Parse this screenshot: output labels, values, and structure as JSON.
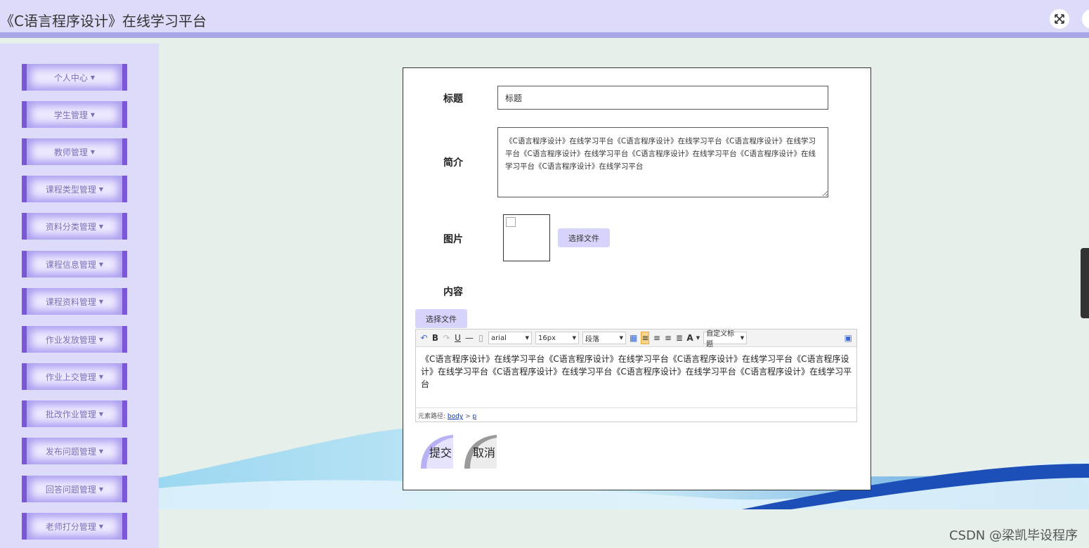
{
  "header": {
    "title": "《C语言程序设计》在线学习平台",
    "fullscreen_icon": "expand-icon",
    "user_icon": "user-icon"
  },
  "sidebar": {
    "items": [
      {
        "label": "个人中心"
      },
      {
        "label": "学生管理"
      },
      {
        "label": "教师管理"
      },
      {
        "label": "课程类型管理"
      },
      {
        "label": "资料分类管理"
      },
      {
        "label": "课程信息管理"
      },
      {
        "label": "课程资料管理"
      },
      {
        "label": "作业发放管理"
      },
      {
        "label": "作业上交管理"
      },
      {
        "label": "批改作业管理"
      },
      {
        "label": "发布问题管理"
      },
      {
        "label": "回答问题管理"
      },
      {
        "label": "老师打分管理"
      }
    ]
  },
  "form": {
    "title_label": "标题",
    "title_value": "标题",
    "intro_label": "简介",
    "intro_value": "《C语言程序设计》在线学习平台《C语言程序设计》在线学习平台《C语言程序设计》在线学习平台《C语言程序设计》在线学习平台《C语言程序设计》在线学习平台《C语言程序设计》在线学习平台《C语言程序设计》在线学习平台",
    "image_label": "图片",
    "file_button": "选择文件",
    "content_label": "内容",
    "editor_file_button": "选择文件",
    "submit": "提交",
    "cancel": "取消"
  },
  "editor": {
    "font_family": "arial",
    "font_size": "16px",
    "paragraph": "段落",
    "custom_title": "自定义标题",
    "bold": "B",
    "underline": "U",
    "font_color": "A",
    "content": "《C语言程序设计》在线学习平台《C语言程序设计》在线学习平台《C语言程序设计》在线学习平台《C语言程序设计》在线学习平台《C语言程序设计》在线学习平台《C语言程序设计》在线学习平台《C语言程序设计》在线学习平台",
    "path_label": "元素路径:",
    "path_body": "body",
    "path_sep": ">",
    "path_p": "p"
  },
  "watermark": "CSDN @梁凯毕设程序",
  "colors": {
    "header_bg": "#dcdcfa",
    "accent": "#7b56d6",
    "page_bg": "#e6efe9"
  }
}
